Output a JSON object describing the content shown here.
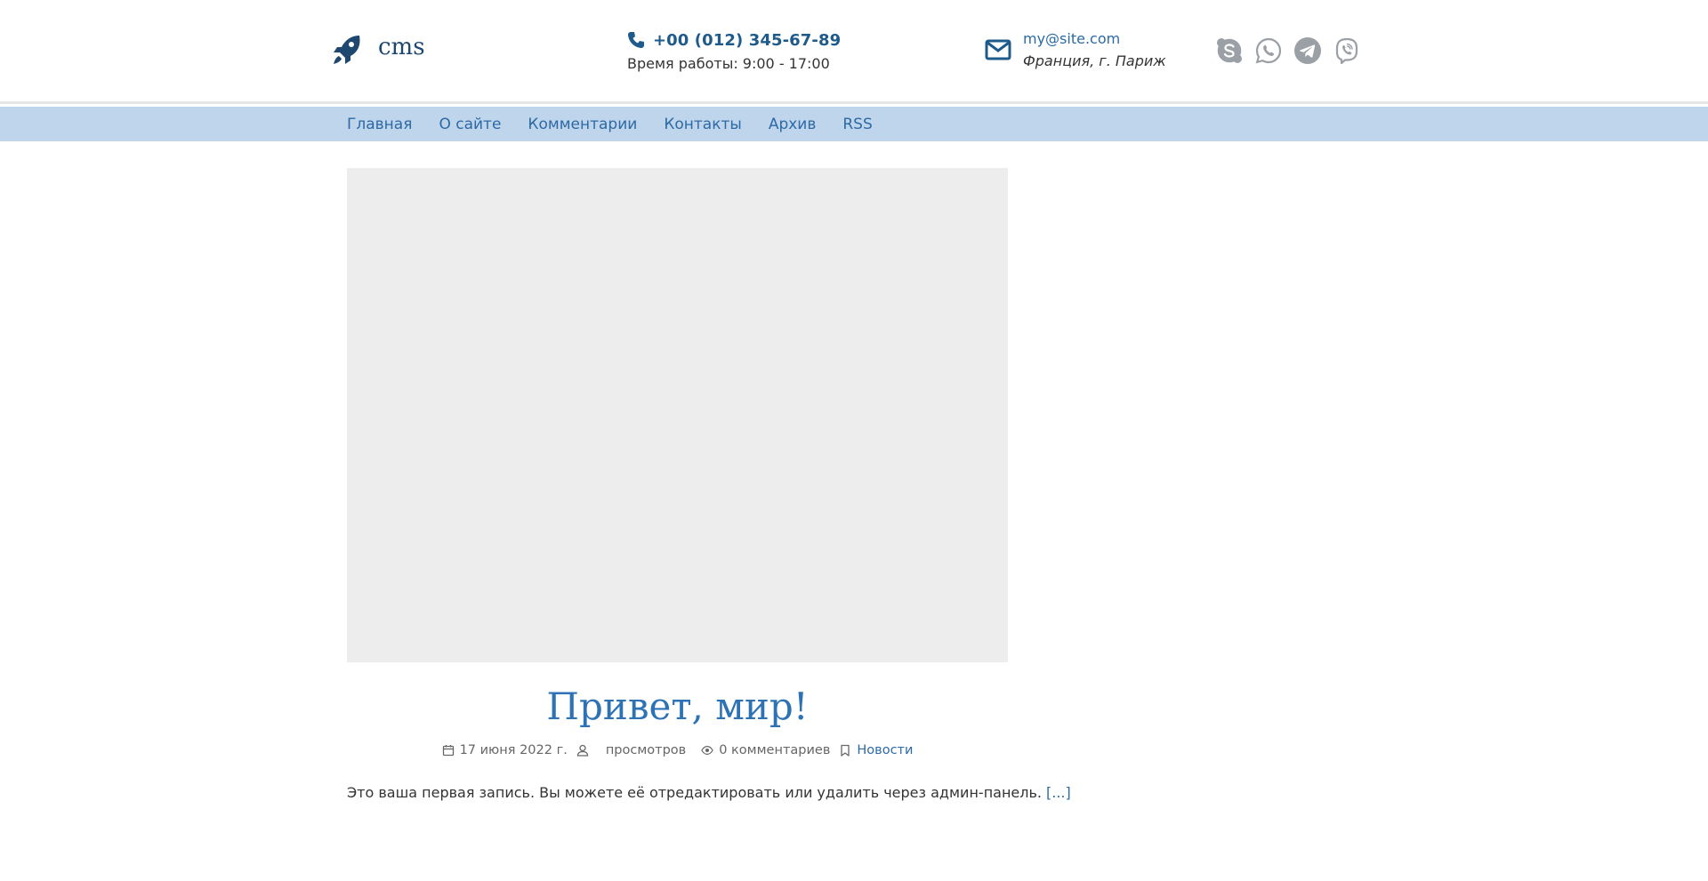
{
  "header": {
    "logo_text": "cms",
    "phone": "+00 (012) 345-67-89",
    "work_hours": "Время работы: 9:00 - 17:00",
    "email": "my@site.com",
    "address": "Франция, г. Париж",
    "socials": [
      {
        "icon": "skype-icon"
      },
      {
        "icon": "whatsapp-icon"
      },
      {
        "icon": "telegram-icon"
      },
      {
        "icon": "viber-icon"
      }
    ]
  },
  "nav": {
    "items": [
      {
        "label": "Главная"
      },
      {
        "label": "О сайте"
      },
      {
        "label": "Комментарии"
      },
      {
        "label": "Контакты"
      },
      {
        "label": "Архив"
      },
      {
        "label": "RSS"
      }
    ]
  },
  "post": {
    "title": "Привет, мир!",
    "date": "17 июня 2022 г.",
    "views": "просмотров",
    "comments": "0 комментариев",
    "category": "Новости",
    "excerpt": "Это ваша первая запись. Вы можете её отредактировать или удалить через админ-панель.",
    "read_more": "[...]"
  },
  "colors": {
    "accent": "#2d6aa5",
    "dark_accent": "#1e4870",
    "nav_background": "#bfd5ec",
    "social_icons": "#9aa0a6",
    "image_placeholder": "#ededed"
  }
}
